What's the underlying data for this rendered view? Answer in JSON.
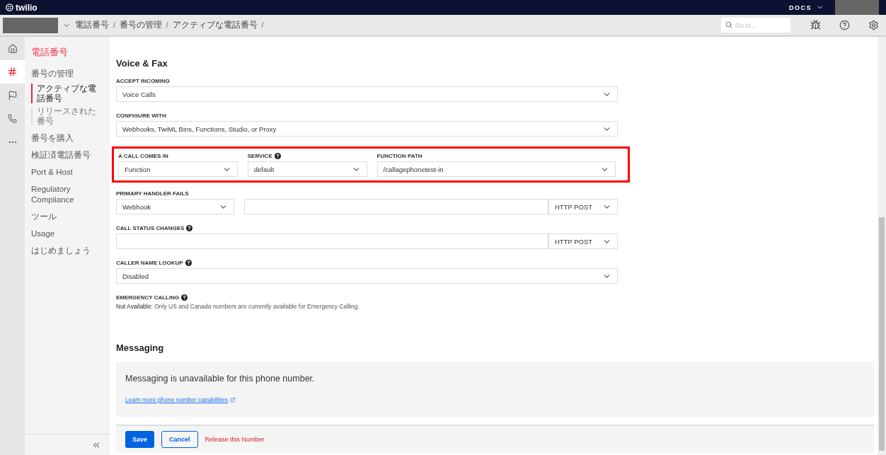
{
  "topbar": {
    "logo": "twilio",
    "docs": "DOCS"
  },
  "breadcrumb": {
    "items": [
      "電話番号",
      "番号の管理",
      "アクティブな電話番号"
    ],
    "separator": "/",
    "search_placeholder": "Go to..."
  },
  "rail": [
    {
      "kind": "home",
      "selected": false
    },
    {
      "kind": "hash",
      "selected": true
    },
    {
      "kind": "flag",
      "selected": false
    },
    {
      "kind": "phone",
      "selected": false
    },
    {
      "kind": "more",
      "selected": false
    }
  ],
  "sidebar": {
    "title": "電話番号",
    "items": [
      {
        "label": "番号の管理",
        "selected": false,
        "children": [
          {
            "label": "アクティブな電話番号",
            "selected": true
          },
          {
            "label": "リリースされた番号",
            "selected": false
          }
        ]
      },
      {
        "label": "番号を購入",
        "selected": false
      },
      {
        "label": "検証済電話番号",
        "selected": false
      },
      {
        "label": "Port & Host",
        "selected": false
      },
      {
        "label": "Regulatory Compliance",
        "selected": false
      },
      {
        "label": "ツール",
        "selected": false
      },
      {
        "label": "Usage",
        "selected": false
      },
      {
        "label": "はじめましょう",
        "selected": false
      }
    ]
  },
  "voice": {
    "title": "Voice & Fax",
    "fields": [
      {
        "kind": "select",
        "label": "ACCEPT INCOMING",
        "help": false,
        "value": "Voice Calls"
      },
      {
        "kind": "select",
        "label": "CONFIGURE WITH",
        "help": false,
        "value": "Webhooks, TwiML Bins, Functions, Studio, or Proxy"
      },
      {
        "kind": "group",
        "highlighted": true,
        "columns": [
          {
            "label": "A CALL COMES IN",
            "help": false,
            "value": "Function"
          },
          {
            "label": "SERVICE",
            "help": true,
            "value": "default"
          },
          {
            "label": "FUNCTION PATH",
            "help": false,
            "value": "/callagephonetest-in"
          }
        ]
      },
      {
        "kind": "handler",
        "label": "PRIMARY HANDLER FAILS",
        "help": false,
        "value": "Webhook",
        "method": "HTTP POST"
      },
      {
        "kind": "url",
        "label": "CALL STATUS CHANGES",
        "help": true,
        "method": "HTTP POST"
      },
      {
        "kind": "select",
        "label": "CALLER NAME LOOKUP",
        "help": true,
        "value": "Disabled"
      },
      {
        "kind": "note",
        "label": "EMERGENCY CALLING",
        "help": true,
        "lead": "Not Available:",
        "note": "Only US and Canada numbers are currently available for Emergency Calling."
      }
    ]
  },
  "messaging": {
    "title": "Messaging",
    "message": "Messaging is unavailable for this phone number.",
    "link": "Learn more phone number capabilities"
  },
  "footer": {
    "buttons": [
      {
        "kind": "primary",
        "label": "Save"
      },
      {
        "kind": "secondary",
        "label": "Cancel"
      },
      {
        "kind": "danger",
        "label": "Release this Number"
      }
    ]
  }
}
